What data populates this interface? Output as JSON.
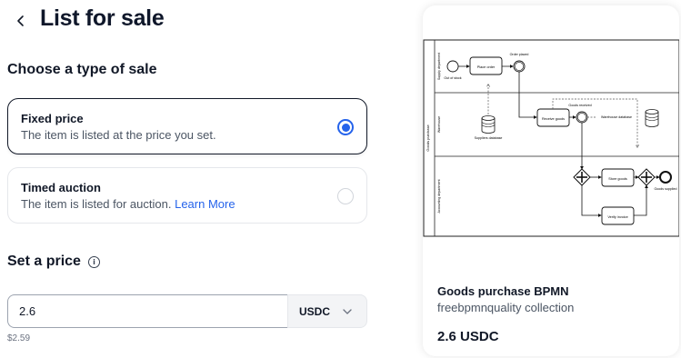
{
  "page": {
    "title": "List for sale"
  },
  "sale_type": {
    "heading": "Choose a type of sale",
    "options": [
      {
        "label": "Fixed price",
        "description": "The item is listed at the price you set.",
        "selected": true
      },
      {
        "label": "Timed auction",
        "description": "The item is listed for auction.",
        "link": "Learn More",
        "selected": false
      }
    ]
  },
  "price": {
    "heading": "Set a price",
    "info_icon": "i",
    "input_value": "2.6",
    "currency": "USDC",
    "converted": "$2.59"
  },
  "preview": {
    "name": "Goods purchase BPMN",
    "collection": "freebpmnquality collection",
    "price": "2.6 USDC",
    "diagram": {
      "pool": "Goods purchase",
      "lanes": [
        "Supply department",
        "Warehouse",
        "Accounting department"
      ],
      "nodes": {
        "out_of_stock": "Out of stock",
        "place_order": "Place order",
        "order_placed": "Order placed",
        "receive_goods": "Receive goods",
        "goods_received": "Goods received",
        "suppliers_database": "Suppliers database",
        "warehouse_database": "Warehouse database",
        "store_goods": "Store goods",
        "verify_invoice": "Verify invoice",
        "goods_supplied": "Goods supplied"
      }
    }
  },
  "colors": {
    "accent": "#2563eb",
    "text": "#111827",
    "muted": "#6b7280"
  }
}
